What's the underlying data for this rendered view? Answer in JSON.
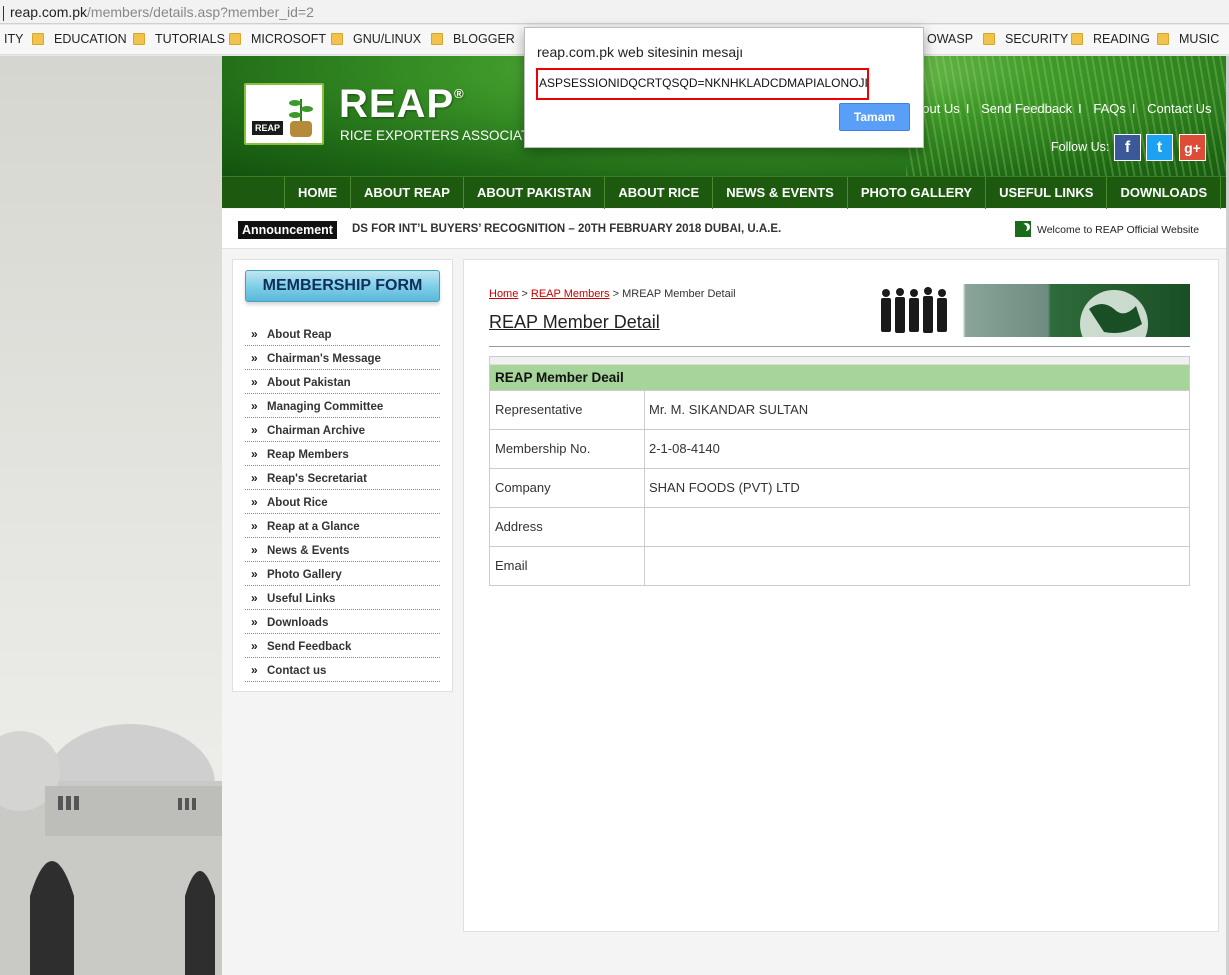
{
  "browser": {
    "address_host": "reap.com.pk",
    "address_path": "/members/details.asp?member_id=2",
    "bookmarks": [
      "ITY",
      "EDUCATION",
      "TUTORIALS",
      "MICROSOFT",
      "GNU/LINUX",
      "BLOGGER",
      "OWASP",
      "SECURITY",
      "READING",
      "MUSIC"
    ]
  },
  "header": {
    "logo_tag": "REAP",
    "logo_title": "REAP",
    "logo_reg": "®",
    "logo_sub": "RICE EXPORTERS ASSOCIATION",
    "top_links": [
      "bout Us",
      "Send Feedback",
      "FAQs",
      "Contact Us"
    ],
    "follow_label": "Follow Us:",
    "social": [
      {
        "icon": "facebook-icon",
        "glyph": "f",
        "color": "#3b5998"
      },
      {
        "icon": "twitter-icon",
        "glyph": "t",
        "color": "#1da1f2"
      },
      {
        "icon": "google-plus-icon",
        "glyph": "g+",
        "color": "#dd4b39"
      }
    ]
  },
  "nav": [
    "HOME",
    "ABOUT REAP",
    "ABOUT PAKISTAN",
    "ABOUT RICE",
    "NEWS & EVENTS",
    "PHOTO GALLERY",
    "USEFUL LINKS",
    "DOWNLOADS"
  ],
  "announcement": {
    "label": "Announcement",
    "text": "DS FOR INT’L BUYERS’ RECOGNITION – 20TH FEBRUARY 2018 DUBAI, U.A.E.",
    "welcome": "Welcome to REAP Official Website"
  },
  "sidebar": {
    "button": "MEMBERSHIP FORM",
    "items": [
      "About Reap",
      "Chairman's Message",
      "About Pakistan",
      "Managing Committee",
      "Chairman Archive",
      "Reap Members",
      "Reap's Secretariat",
      "About Rice",
      "Reap at a Glance",
      "News & Events",
      "Photo Gallery",
      "Useful Links",
      "Downloads",
      "Send Feedback",
      "Contact us"
    ]
  },
  "main": {
    "breadcrumb": {
      "home": "Home",
      "members": "REAP Members",
      "current": "MREAP Member Detail"
    },
    "title": "REAP Member Detail",
    "table_header": "REAP Member Deail",
    "rows": [
      {
        "label": "Representative",
        "value": "Mr. M. SIKANDAR SULTAN"
      },
      {
        "label": "Membership No.",
        "value": "2-1-08-4140"
      },
      {
        "label": "Company",
        "value": "SHAN FOODS (PVT) LTD"
      },
      {
        "label": "Address",
        "value": ""
      },
      {
        "label": "Email",
        "value": ""
      }
    ]
  },
  "dialog": {
    "title": "reap.com.pk web sitesinin mesajı",
    "message": "ASPSESSIONIDQCRTQSQD=NKNHKLADCDMAPIALONOJIFDD",
    "ok": "Tamam"
  }
}
